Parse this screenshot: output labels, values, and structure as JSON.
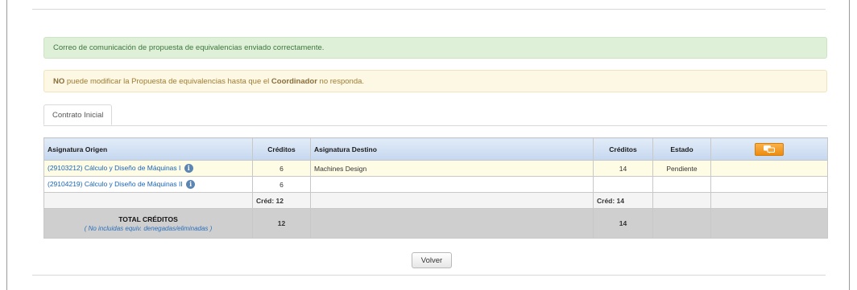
{
  "alerts": {
    "success": "Correo de comunicación de propuesta de equivalencias enviado correctamente.",
    "warning_strong1": "NO",
    "warning_text1": " puede modificar la Propuesta de equivalencias hasta que el ",
    "warning_strong2": "Coordinador",
    "warning_text2": " no responda."
  },
  "tabs": [
    {
      "label": "Contrato Inicial",
      "active": true
    }
  ],
  "table": {
    "headers": {
      "origen": "Asignatura Origen",
      "creditos_origen": "Créditos",
      "destino": "Asignatura Destino",
      "creditos_destino": "Créditos",
      "estado": "Estado",
      "action_icon": "speech-bubbles-icon"
    },
    "rows": [
      {
        "origen": "(29103212) Cálculo y Diseño de Máquinas I",
        "creditos_origen": "6",
        "destino": "Machines Design",
        "creditos_destino": "14",
        "estado": "Pendiente"
      },
      {
        "origen": "(29104219) Cálculo y Diseño de Máquinas II",
        "creditos_origen": "6",
        "destino": "",
        "creditos_destino": "",
        "estado": ""
      }
    ],
    "subtotal": {
      "origen": "Créd: 12",
      "destino": "Créd: 14"
    },
    "total": {
      "title": "TOTAL CRÉDITOS",
      "note": "( No incluidas equiv. denegadas/eliminadas )",
      "origen": "12",
      "destino": "14"
    }
  },
  "buttons": {
    "volver": "Volver"
  },
  "colors": {
    "success_bg": "#dff0d8",
    "warning_bg": "#fcf8e3",
    "header_blue": "#c5d7ef",
    "highlight_row": "#fefce5",
    "total_row": "#cfcfcf",
    "action_orange": "#ec8c12",
    "link": "#1a63b5"
  }
}
